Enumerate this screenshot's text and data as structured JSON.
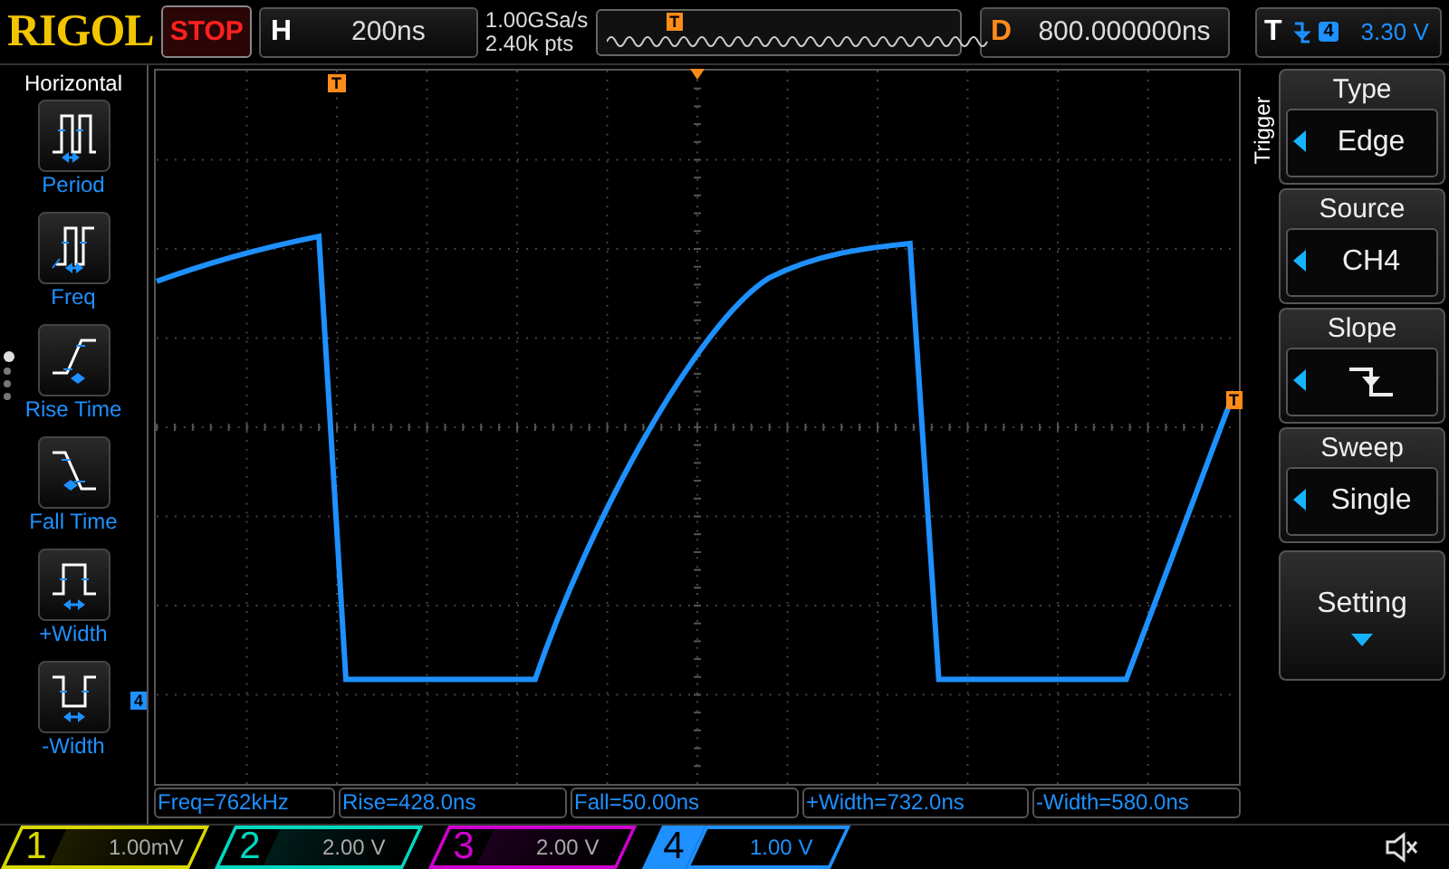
{
  "brand": "RIGOL",
  "run_state": "STOP",
  "timebase": {
    "label": "H",
    "value": "200ns"
  },
  "acquisition": {
    "sample_rate": "1.00GSa/s",
    "memory_depth": "2.40k pts"
  },
  "overview": {
    "trigger_marker": "T"
  },
  "delay": {
    "label": "D",
    "value": "800.000000ns"
  },
  "trigger_status": {
    "label": "T",
    "source": "4",
    "level": "3.30 V"
  },
  "left_menu": {
    "title": "Horizontal",
    "pages": [
      {
        "selected": true
      },
      {
        "selected": false
      },
      {
        "selected": false
      },
      {
        "selected": false
      }
    ],
    "items": [
      {
        "label": "Period",
        "kind": "period"
      },
      {
        "label": "Freq",
        "kind": "freq"
      },
      {
        "label": "Rise Time",
        "kind": "rise"
      },
      {
        "label": "Fall Time",
        "kind": "fall"
      },
      {
        "label": "+Width",
        "kind": "pwidth"
      },
      {
        "label": "-Width",
        "kind": "nwidth"
      }
    ]
  },
  "screen": {
    "trigger_position_marker": "T",
    "trigger_level_marker": "T",
    "channel_marker": "4"
  },
  "right_menu": {
    "title": "Trigger",
    "items": [
      {
        "kind": "value",
        "title": "Type",
        "value": "Edge"
      },
      {
        "kind": "value",
        "title": "Source",
        "value": "CH4"
      },
      {
        "kind": "slope",
        "title": "Slope"
      },
      {
        "kind": "value",
        "title": "Sweep",
        "value": "Single"
      },
      {
        "kind": "more",
        "title": "Setting"
      }
    ]
  },
  "measurements": [
    "Freq=762kHz",
    "Rise=428.0ns",
    "Fall=50.00ns",
    "+Width=732.0ns",
    "-Width=580.0ns"
  ],
  "channels": [
    {
      "number": "1",
      "scale": "1.00mV",
      "color": "#d8d800",
      "selected": false
    },
    {
      "number": "2",
      "scale": "2.00 V",
      "color": "#00d8c0",
      "selected": false
    },
    {
      "number": "3",
      "scale": "2.00 V",
      "color": "#d000d0",
      "selected": false
    },
    {
      "number": "4",
      "scale": "1.00 V",
      "color": "#1e90ff",
      "selected": true
    }
  ]
}
